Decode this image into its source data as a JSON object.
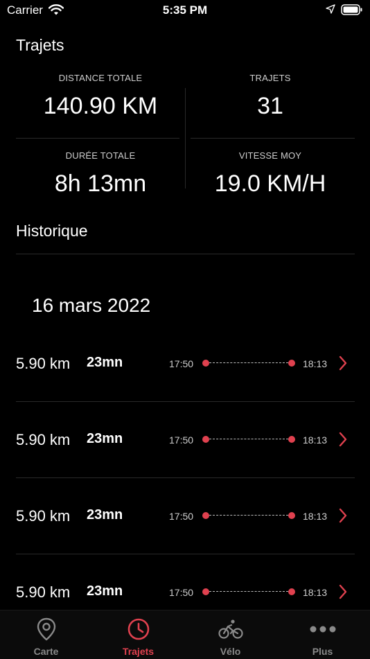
{
  "status_bar": {
    "carrier": "Carrier",
    "time": "5:35 PM"
  },
  "screen": {
    "title": "Trajets"
  },
  "stats": {
    "total_distance_label": "DISTANCE TOTALE",
    "total_distance_value": "140.90 KM",
    "trips_label": "TRAJETS",
    "trips_value": "31",
    "total_duration_label": "DURÉE TOTALE",
    "total_duration_value": "8h 13mn",
    "avg_speed_label": "VITESSE MOY",
    "avg_speed_value": "19.0 KM/H"
  },
  "history": {
    "title": "Historique",
    "date": "16 mars 2022",
    "trips": [
      {
        "distance": "5.90 km",
        "duration": "23mn",
        "start": "17:50",
        "end": "18:13"
      },
      {
        "distance": "5.90 km",
        "duration": "23mn",
        "start": "17:50",
        "end": "18:13"
      },
      {
        "distance": "5.90 km",
        "duration": "23mn",
        "start": "17:50",
        "end": "18:13"
      },
      {
        "distance": "5.90 km",
        "duration": "23mn",
        "start": "17:50",
        "end": "18:13"
      }
    ]
  },
  "tab_bar": {
    "tabs": [
      {
        "label": "Carte",
        "icon": "map-pin-icon"
      },
      {
        "label": "Trajets",
        "icon": "clock-icon"
      },
      {
        "label": "Vélo",
        "icon": "bike-icon"
      },
      {
        "label": "Plus",
        "icon": "more-icon"
      }
    ],
    "active_index": 1
  },
  "colors": {
    "accent": "#e0414f",
    "background": "#000000",
    "divider": "#2a2a2a"
  }
}
